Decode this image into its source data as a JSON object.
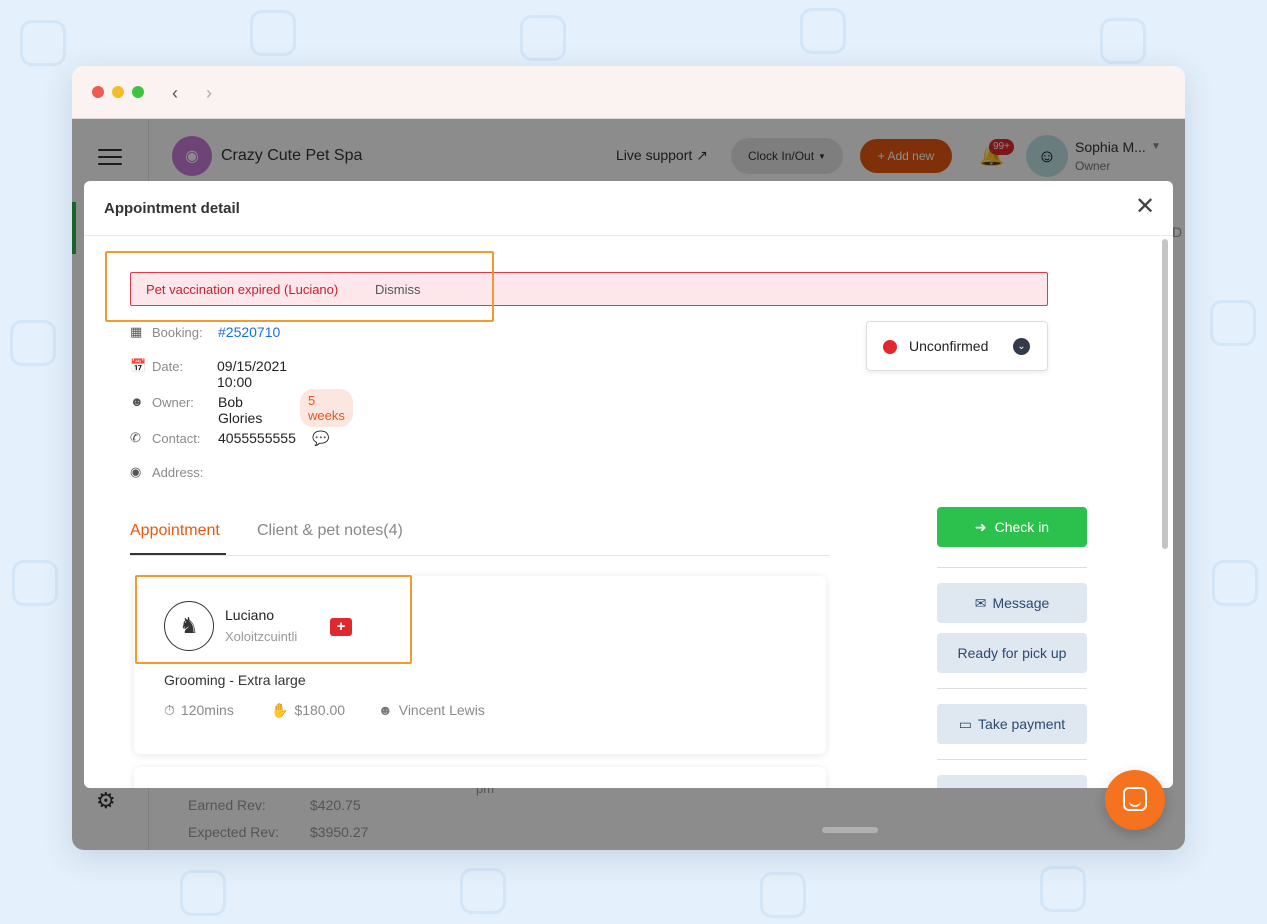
{
  "browser": {
    "back_icon": "chevron-left-icon",
    "forward_icon": "chevron-right-icon"
  },
  "header": {
    "brand_name": "Crazy Cute Pet Spa",
    "live_support": "Live support",
    "clock_in_out": "Clock In/Out",
    "add_new": "+ Add new",
    "notification_count": "99+",
    "user_name": "Sophia M...",
    "user_role": "Owner"
  },
  "background_stats": {
    "earned_label": "Earned Rev:",
    "earned_value": "$420.75",
    "expected_label": "Expected Rev:",
    "expected_value": "$3950.27",
    "calendar_fragment": "pm",
    "cut_off_char": "D"
  },
  "modal": {
    "title": "Appointment detail",
    "alert_text": "Pet vaccination expired (Luciano)",
    "alert_dismiss": "Dismiss",
    "booking_label": "Booking:",
    "booking_value": "#2520710",
    "date_label": "Date:",
    "date_value": "09/15/2021 10:00",
    "owner_label": "Owner:",
    "owner_value": "Bob Glories",
    "owner_badge": "5 weeks",
    "contact_label": "Contact:",
    "contact_value": "4055555555",
    "address_label": "Address:",
    "status": "Unconfirmed",
    "tabs": [
      {
        "label": "Appointment",
        "active": true
      },
      {
        "label": "Client & pet notes(4)",
        "active": false
      }
    ],
    "pet": {
      "name": "Luciano",
      "breed": "Xoloitzcuintli",
      "service": "Grooming - Extra large",
      "duration": "120mins",
      "price": "$180.00",
      "staff": "Vincent Lewis"
    },
    "actions": {
      "check_in": "Check in",
      "message": "Message",
      "ready": "Ready for pick up",
      "take_payment": "Take payment"
    }
  },
  "colors": {
    "accent_orange": "#e8580f",
    "alert_red": "#e03a4a",
    "check_in_green": "#2cc14d",
    "link_blue": "#1a6fe0",
    "highlight_orange": "#f39a2e"
  }
}
